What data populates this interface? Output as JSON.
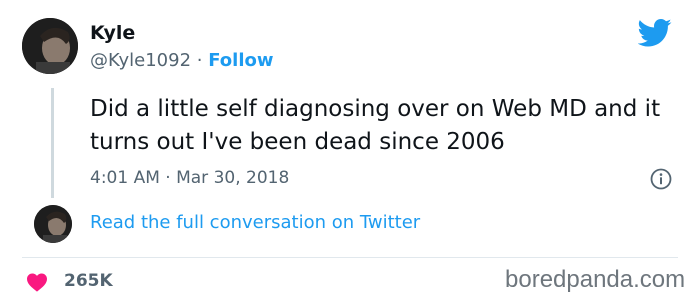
{
  "tweet": {
    "author": {
      "name": "Kyle",
      "handle": "@Kyle1092",
      "separator": "·",
      "follow_label": "Follow"
    },
    "text": "Did a little self diagnosing over on Web MD and it turns out I've been dead since 2006",
    "timestamp": "4:01 AM · Mar 30, 2018",
    "read_full_label": "Read the full conversation on Twitter",
    "likes": "265K"
  },
  "icons": {
    "brand": "twitter-bird-icon",
    "info": "info-icon",
    "like": "heart-icon"
  },
  "watermark": "boredpanda.com",
  "colors": {
    "accent": "#1d9bf0",
    "heart": "#f91880",
    "text": "#0f1419",
    "muted": "#536471"
  }
}
